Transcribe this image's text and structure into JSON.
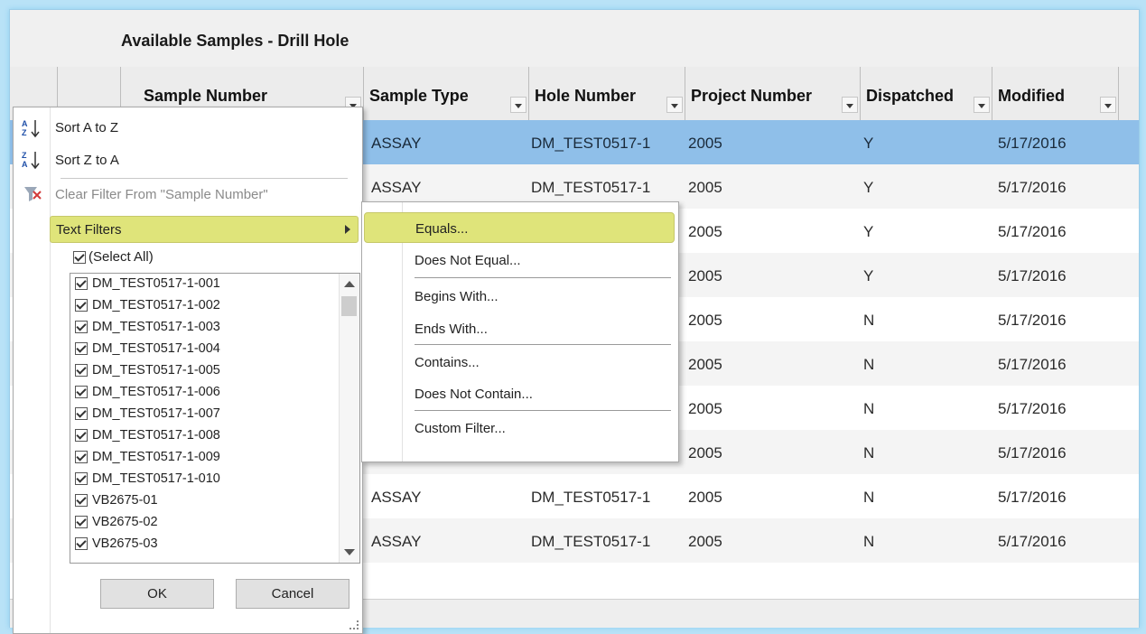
{
  "title": "Available Samples - Drill Hole",
  "columns": [
    "Sample Number",
    "Sample Type",
    "Hole Number",
    "Project Number",
    "Dispatched",
    "Modified"
  ],
  "rows": [
    {
      "type": "ASSAY",
      "hole": "DM_TEST0517-1",
      "project": "2005",
      "dispatched": "Y",
      "modified": "5/17/2016"
    },
    {
      "type": "ASSAY",
      "hole": "DM_TEST0517-1",
      "project": "2005",
      "dispatched": "Y",
      "modified": "5/17/2016"
    },
    {
      "type": "",
      "hole": "",
      "project": "2005",
      "dispatched": "Y",
      "modified": "5/17/2016"
    },
    {
      "type": "",
      "hole": "",
      "project": "2005",
      "dispatched": "Y",
      "modified": "5/17/2016"
    },
    {
      "type": "",
      "hole": "",
      "project": "2005",
      "dispatched": "N",
      "modified": "5/17/2016"
    },
    {
      "type": "",
      "hole": "",
      "project": "2005",
      "dispatched": "N",
      "modified": "5/17/2016"
    },
    {
      "type": "",
      "hole": "",
      "project": "2005",
      "dispatched": "N",
      "modified": "5/17/2016"
    },
    {
      "type": "",
      "hole": "",
      "project": "2005",
      "dispatched": "N",
      "modified": "5/17/2016"
    },
    {
      "type": "ASSAY",
      "hole": "DM_TEST0517-1",
      "project": "2005",
      "dispatched": "N",
      "modified": "5/17/2016"
    },
    {
      "type": "ASSAY",
      "hole": "DM_TEST0517-1",
      "project": "2005",
      "dispatched": "N",
      "modified": "5/17/2016"
    }
  ],
  "menu": {
    "sort_asc": "Sort A to Z",
    "sort_desc": "Sort Z to A",
    "clear_filter": "Clear Filter From \"Sample Number\"",
    "text_filters": "Text Filters",
    "select_all": "(Select All)",
    "values": [
      "DM_TEST0517-1-001",
      "DM_TEST0517-1-002",
      "DM_TEST0517-1-003",
      "DM_TEST0517-1-004",
      "DM_TEST0517-1-005",
      "DM_TEST0517-1-006",
      "DM_TEST0517-1-007",
      "DM_TEST0517-1-008",
      "DM_TEST0517-1-009",
      "DM_TEST0517-1-010",
      "VB2675-01",
      "VB2675-02",
      "VB2675-03"
    ],
    "ok": "OK",
    "cancel": "Cancel"
  },
  "submenu": {
    "items": [
      "Equals...",
      "Does Not Equal...",
      "Begins With...",
      "Ends With...",
      "Contains...",
      "Does Not Contain...",
      "Custom Filter..."
    ]
  },
  "colors": {
    "selected_row": "#8fbfe9",
    "highlight": "#dfe47a",
    "frame_glow": "#b9e2f7"
  }
}
